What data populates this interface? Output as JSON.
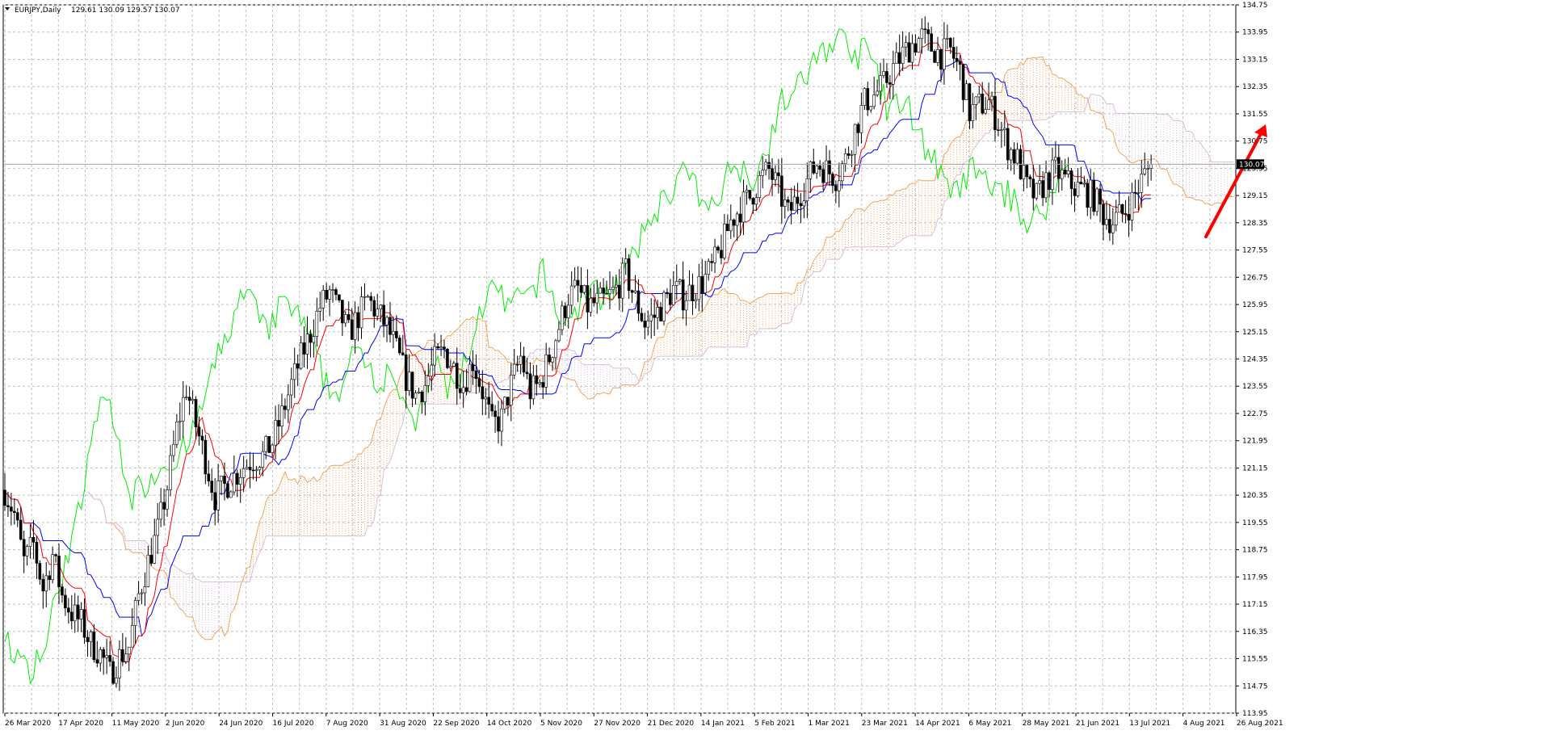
{
  "header": {
    "symbol": "EURJPY,Daily",
    "ohlc": "129.61 130.09 129.57 130.07"
  },
  "colors": {
    "background": "#ffffff",
    "grid": "#c0c0c0",
    "candle": "#000000",
    "tenkan": "#ff0000",
    "kijun": "#0000ff",
    "chikou": "#00ee00",
    "cloud_bull": "#f4a460",
    "cloud_bear": "#d8bfd8",
    "arrow": "#ff0000",
    "price_tag_bg": "#000000",
    "price_tag_fg": "#ffffff"
  },
  "chart_data": {
    "type": "candlestick",
    "indicator": "Ichimoku",
    "ylim": [
      113.95,
      134.75
    ],
    "y_ticks": [
      "134.75",
      "133.95",
      "133.15",
      "132.35",
      "131.55",
      "130.75",
      "129.95",
      "129.15",
      "128.35",
      "127.55",
      "126.75",
      "125.95",
      "125.15",
      "124.35",
      "123.55",
      "122.75",
      "121.95",
      "121.15",
      "120.35",
      "119.55",
      "118.75",
      "117.95",
      "117.15",
      "116.35",
      "115.55",
      "114.75",
      "113.95"
    ],
    "x_labels": [
      "26 Mar 2020",
      "17 Apr 2020",
      "11 May 2020",
      "2 Jun 2020",
      "24 Jun 2020",
      "16 Jul 2020",
      "7 Aug 2020",
      "31 Aug 2020",
      "22 Sep 2020",
      "14 Oct 2020",
      "5 Nov 2020",
      "27 Nov 2020",
      "21 Dec 2020",
      "14 Jan 2021",
      "5 Feb 2021",
      "1 Mar 2021",
      "23 Mar 2021",
      "14 Apr 2021",
      "6 May 2021",
      "28 May 2021",
      "21 Jun 2021",
      "13 Jul 2021",
      "4 Aug 2021",
      "26 Aug 2021"
    ],
    "current_price": "130.07",
    "close_path": [
      [
        0,
        120.5
      ],
      [
        3,
        119.8
      ],
      [
        6,
        118.4
      ],
      [
        9,
        118.9
      ],
      [
        12,
        117.6
      ],
      [
        15,
        118.6
      ],
      [
        18,
        117.4
      ],
      [
        21,
        116.9
      ],
      [
        24,
        116.6
      ],
      [
        27,
        116.0
      ],
      [
        30,
        115.7
      ],
      [
        33,
        115.1
      ],
      [
        36,
        115.6
      ],
      [
        39,
        115.9
      ],
      [
        42,
        117.4
      ],
      [
        45,
        118.4
      ],
      [
        48,
        119.3
      ],
      [
        51,
        120.6
      ],
      [
        54,
        122.3
      ],
      [
        57,
        123.5
      ],
      [
        60,
        122.4
      ],
      [
        63,
        121.4
      ],
      [
        66,
        120.3
      ],
      [
        69,
        120.6
      ],
      [
        72,
        120.9
      ],
      [
        75,
        121.2
      ],
      [
        78,
        121.4
      ],
      [
        81,
        121.5
      ],
      [
        84,
        121.9
      ],
      [
        87,
        122.7
      ],
      [
        90,
        123.6
      ],
      [
        93,
        124.4
      ],
      [
        96,
        125.1
      ],
      [
        99,
        125.9
      ],
      [
        102,
        126.3
      ],
      [
        105,
        125.7
      ],
      [
        108,
        125.1
      ],
      [
        111,
        125.6
      ],
      [
        114,
        126.1
      ],
      [
        117,
        125.7
      ],
      [
        120,
        125.3
      ],
      [
        123,
        124.6
      ],
      [
        126,
        123.8
      ],
      [
        129,
        123.3
      ],
      [
        132,
        123.6
      ],
      [
        135,
        124.3
      ],
      [
        138,
        124.6
      ],
      [
        141,
        124.1
      ],
      [
        144,
        123.6
      ],
      [
        147,
        124.3
      ],
      [
        150,
        123.4
      ],
      [
        153,
        122.4
      ],
      [
        156,
        122.6
      ],
      [
        159,
        123.6
      ],
      [
        162,
        124.4
      ],
      [
        165,
        123.4
      ],
      [
        168,
        123.6
      ],
      [
        171,
        124.4
      ],
      [
        174,
        125.3
      ],
      [
        177,
        126.2
      ],
      [
        180,
        126.4
      ],
      [
        183,
        125.9
      ],
      [
        186,
        126.0
      ],
      [
        189,
        126.1
      ],
      [
        192,
        126.4
      ],
      [
        195,
        126.9
      ],
      [
        198,
        126.1
      ],
      [
        201,
        125.4
      ],
      [
        204,
        125.6
      ],
      [
        207,
        126.0
      ],
      [
        210,
        126.4
      ],
      [
        213,
        126.2
      ],
      [
        216,
        126.4
      ],
      [
        219,
        126.6
      ],
      [
        222,
        127.0
      ],
      [
        225,
        127.6
      ],
      [
        228,
        128.4
      ],
      [
        231,
        128.8
      ],
      [
        234,
        129.1
      ],
      [
        237,
        129.6
      ],
      [
        240,
        129.9
      ],
      [
        243,
        129.3
      ],
      [
        246,
        128.6
      ],
      [
        249,
        129.1
      ],
      [
        252,
        129.6
      ],
      [
        255,
        130.1
      ],
      [
        258,
        129.9
      ],
      [
        261,
        129.7
      ],
      [
        264,
        130.2
      ],
      [
        267,
        131.1
      ],
      [
        270,
        131.9
      ],
      [
        273,
        132.1
      ],
      [
        276,
        132.4
      ],
      [
        279,
        132.9
      ],
      [
        282,
        133.3
      ],
      [
        285,
        133.6
      ],
      [
        288,
        133.8
      ],
      [
        291,
        133.5
      ],
      [
        294,
        133.3
      ],
      [
        297,
        133.4
      ],
      [
        300,
        132.8
      ],
      [
        303,
        131.6
      ],
      [
        306,
        131.8
      ],
      [
        309,
        131.9
      ],
      [
        312,
        131.3
      ],
      [
        315,
        130.6
      ],
      [
        318,
        130.2
      ],
      [
        321,
        129.4
      ],
      [
        324,
        129.1
      ],
      [
        327,
        129.6
      ],
      [
        330,
        129.9
      ],
      [
        333,
        129.6
      ],
      [
        336,
        129.4
      ],
      [
        339,
        129.3
      ],
      [
        342,
        129.1
      ],
      [
        345,
        128.6
      ],
      [
        348,
        128.4
      ],
      [
        351,
        128.6
      ],
      [
        354,
        129.0
      ],
      [
        357,
        129.6
      ],
      [
        360,
        130.07
      ]
    ]
  },
  "annotations": {
    "arrow": {
      "direction": "up-right",
      "meaning": "bullish"
    }
  }
}
